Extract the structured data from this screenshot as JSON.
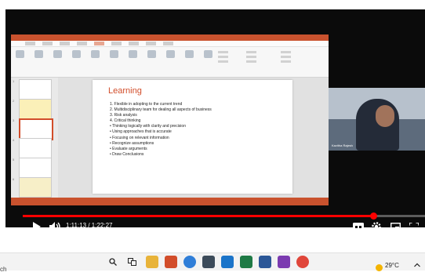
{
  "slide": {
    "title": "Learning",
    "items": [
      "1.  Flexible in adopting to the current trend",
      "2.  Multidisciplinary team for dealing all aspects of business",
      "3.  Risk analysis",
      "4.  Critical thinking",
      "•  Thinking logically with clarity and precision",
      "•  Using approaches that is accurate",
      "•  Focusing on relevant information",
      "•  Recognize assumptions",
      "•  Evaluate arguments",
      "•  Draw Conclusions"
    ]
  },
  "thumbnails": [
    "1",
    "2",
    "3",
    "4",
    "5",
    "6"
  ],
  "player": {
    "time_current": "1:11:13",
    "time_total": "1:22:27",
    "progress": 0.863,
    "accent": "#ff0000",
    "icons": [
      "play-icon",
      "volume-icon",
      "captions-icon",
      "settings-icon",
      "miniplayer-icon",
      "fullscreen-icon"
    ]
  },
  "webcam": {
    "name": "Kavitha Rajesh"
  },
  "taskbar": {
    "search_text": "ch",
    "temperature": "29°C",
    "apps": [
      "search-icon",
      "task-view-icon",
      "file-explorer-icon",
      "powerpoint-icon",
      "edge-icon",
      "store-icon",
      "mail-icon",
      "excel-icon",
      "word-icon",
      "onenote-icon",
      "chrome-icon"
    ]
  },
  "colors": {
    "powerpoint_accent": "#c9522e",
    "slide_title": "#d24d2a"
  }
}
